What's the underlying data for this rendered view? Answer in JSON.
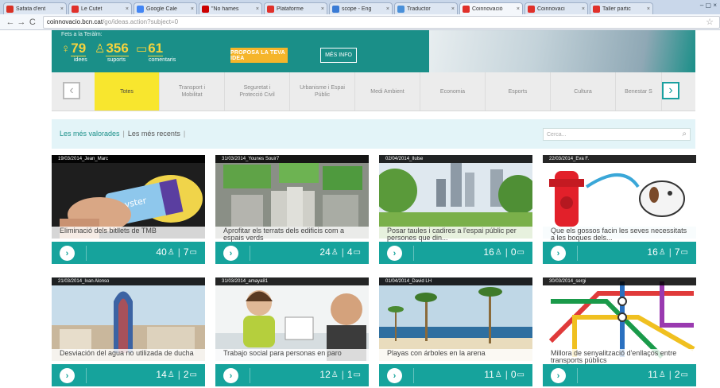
{
  "browser": {
    "tabs": [
      {
        "label": "Safata d'ent",
        "favicon_color": "#d93025",
        "active": false
      },
      {
        "label": "Le Cutet",
        "favicon_color": "#e0302a",
        "active": false
      },
      {
        "label": "Google Cale",
        "favicon_color": "#4285f4",
        "active": false
      },
      {
        "label": "\"No hames",
        "favicon_color": "#cc0000",
        "active": false
      },
      {
        "label": "Plataforme",
        "favicon_color": "#e0302a",
        "active": false
      },
      {
        "label": "scope - Eng",
        "favicon_color": "#3a7bd5",
        "active": false
      },
      {
        "label": "Traductor",
        "favicon_color": "#4a90d9",
        "active": false
      },
      {
        "label": "Coinnovació",
        "favicon_color": "#e0302a",
        "active": true
      },
      {
        "label": "Coinnovaci",
        "favicon_color": "#e0302a",
        "active": false
      },
      {
        "label": "Taller partic",
        "favicon_color": "#e0302a",
        "active": false
      }
    ],
    "tab_close": "×",
    "window_controls": "– ▢ ×",
    "back": "←",
    "forward": "→",
    "reload": "C",
    "url_domain": "coinnovacio.bcn.cat",
    "url_path": "/go/ideas.action?subject=0",
    "star": "☆"
  },
  "header": {
    "stats_title": "Fets a la Teràlm:",
    "stats": [
      {
        "icon": "lightbulb-icon",
        "glyph": "♀",
        "value": "79",
        "label": "idees"
      },
      {
        "icon": "thumbs-up-icon",
        "glyph": "♙",
        "value": "356",
        "label": "suports"
      },
      {
        "icon": "comment-icon",
        "glyph": "▭",
        "value": "61",
        "label": "comentaris"
      }
    ],
    "propose_label": "PROPOSA LA TEVA IDEA",
    "info_label": "MÉS INFO"
  },
  "categories": {
    "prev": "‹",
    "next": "›",
    "items": [
      {
        "label": "Totes",
        "active": true
      },
      {
        "label": "Transport i Mobilitat",
        "active": false
      },
      {
        "label": "Seguretat i Protecció Civil",
        "active": false
      },
      {
        "label": "Urbanisme i Espai Públic",
        "active": false
      },
      {
        "label": "Medi Ambient",
        "active": false
      },
      {
        "label": "Economia",
        "active": false
      },
      {
        "label": "Esports",
        "active": false
      },
      {
        "label": "Cultura",
        "active": false
      },
      {
        "label": "Benestar S",
        "active": false
      }
    ]
  },
  "filters": {
    "most_rated": "Les més valorades",
    "separator": "|",
    "most_recent": "Les més recents",
    "trailing": "|",
    "search_placeholder": "Cerca...",
    "search_icon": "⌕"
  },
  "ideas": [
    {
      "meta": "19/03/2014_Jean_Marc",
      "title": "Eliminació dels bitllets de TMB",
      "likes": "40",
      "comments": "7",
      "image": "oyster-card"
    },
    {
      "meta": "31/03/2014_Younes Souir7",
      "title": "Aprofitar els terrats dels edificis com a espais verds",
      "likes": "24",
      "comments": "4",
      "image": "green-roofs"
    },
    {
      "meta": "02/04/2014_Ilulse",
      "title": "Posar taules i cadires a l'espai públic per persones que din...",
      "likes": "16",
      "comments": "0",
      "image": "city-park"
    },
    {
      "meta": "22/03/2014_Eva F.",
      "title": "Que els gossos facin les seves necessitats a les boques dels...",
      "likes": "16",
      "comments": "7",
      "image": "dog-hydrant"
    },
    {
      "meta": "21/03/2014_Ivan Alonso",
      "title": "Desviación del agua no utilizada de ducha",
      "likes": "14",
      "comments": "2",
      "image": "agbar-tower"
    },
    {
      "meta": "31/03/2014_amaya81",
      "title": "Trabajo social para personas en paro",
      "likes": "12",
      "comments": "1",
      "image": "people-office"
    },
    {
      "meta": "01/04/2014_David LH",
      "title": "Playas con árboles en la arena",
      "likes": "11",
      "comments": "0",
      "image": "palm-beach"
    },
    {
      "meta": "30/03/2014_sergi",
      "title": "Millora de senyalització d'enllaços entre transports públics",
      "likes": "11",
      "comments": "2",
      "image": "metro-map"
    }
  ],
  "card_ui": {
    "go_glyph": "›",
    "like_glyph": "♙",
    "comment_glyph": "▭",
    "sep": "|"
  },
  "colors": {
    "teal": "#16a39c",
    "yellow": "#f8e62e",
    "orange": "#f5b52a"
  }
}
